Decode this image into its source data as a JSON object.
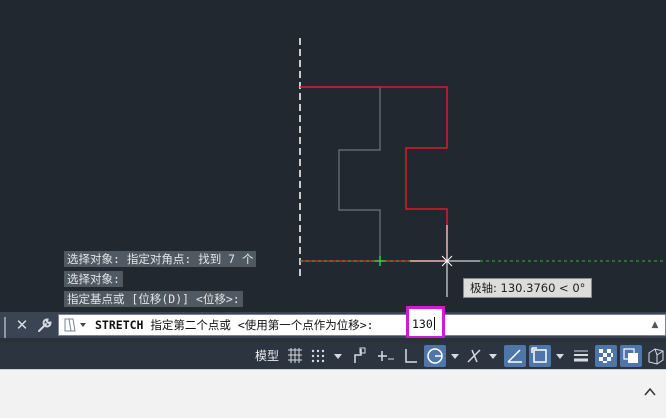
{
  "command_history": [
    "选择对象: 指定对角点: 找到 7 个",
    "选择对象:",
    "指定基点或 [位移(D)] <位移>:"
  ],
  "command_line": {
    "command": "STRETCH",
    "prompt": " 指定第二个点或 <使用第一个点作为位移>:",
    "input_value": "130"
  },
  "tooltip": {
    "text": "极轴: 130.3760 < 0°"
  },
  "status_bar": {
    "model_label": "模型"
  },
  "colors": {
    "canvas_bg": "#212830",
    "selection_red": "#e0182c",
    "original_gray": "#6e7680",
    "polar_track_green": "#3fae3f",
    "input_highlight": "#d01bd6"
  },
  "icons": {
    "close": "close-icon",
    "customize": "wrench-icon",
    "recent": "recent-commands-icon",
    "expand": "chevron-up-icon"
  }
}
